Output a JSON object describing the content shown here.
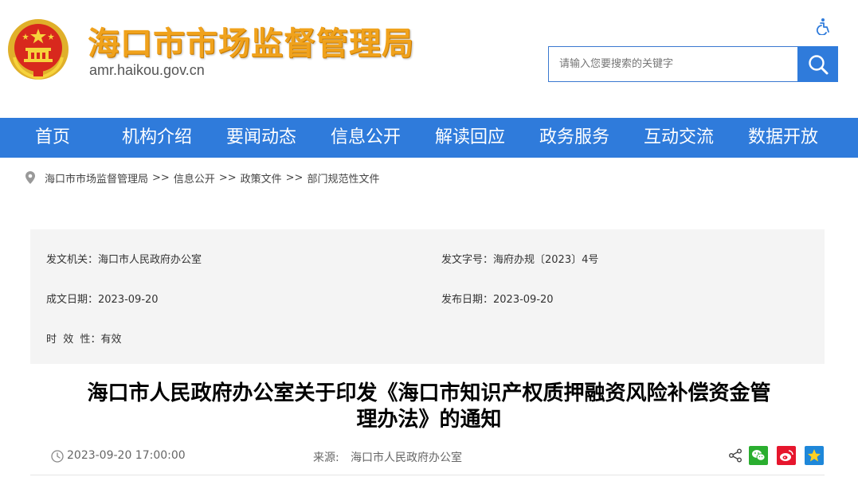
{
  "header": {
    "site_title": "海口市市场监督管理局",
    "site_domain": "amr.haikou.gov.cn",
    "search_placeholder": "请输入您要搜索的关键字"
  },
  "nav": {
    "items": [
      "首页",
      "机构介绍",
      "要闻动态",
      "信息公开",
      "解读回应",
      "政务服务",
      "互动交流",
      "数据开放"
    ]
  },
  "breadcrumb": {
    "items": [
      "海口市市场监督管理局",
      "信息公开",
      "政策文件",
      "部门规范性文件"
    ],
    "separator": ">>"
  },
  "meta": {
    "issuer_label": "发文机关：",
    "issuer_value": "海口市人民政府办公室",
    "doc_no_label": "发文字号：",
    "doc_no_value": "海府办规〔2023〕4号",
    "created_label": "成文日期：",
    "created_value": "2023-09-20",
    "published_label": "发布日期：",
    "published_value": "2023-09-20",
    "validity_label": "时  效  性：",
    "validity_value": "有效"
  },
  "article": {
    "title_line1": "海口市人民政府办公室关于印发《海口市知识产权质押融资风险补偿资金管",
    "title_line2": "理办法》的通知",
    "datetime": "2023-09-20 17:00:00",
    "source_label": "来源:",
    "source_value": "海口市人民政府办公室"
  },
  "share": {
    "icons": [
      "share-icon",
      "wechat-icon",
      "weibo-icon",
      "qzone-icon"
    ]
  },
  "colors": {
    "brand_blue": "#2f7bdb",
    "title_orange": "#f0a21c",
    "wechat_green": "#2aae2f",
    "weibo_red": "#e6162d",
    "qzone_blue": "#1e87d9"
  }
}
